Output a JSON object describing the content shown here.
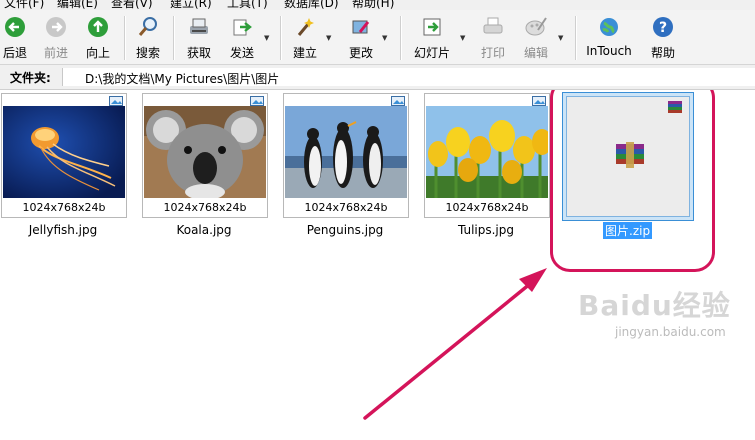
{
  "menu": [
    "文件(F)",
    "编辑(E)",
    "查看(V)",
    "建立(R)",
    "工具(T)",
    "数据库(D)",
    "帮助(H)"
  ],
  "toolbar": {
    "back": "后退",
    "forward": "前进",
    "up": "向上",
    "search": "搜索",
    "acquire": "获取",
    "send": "发送",
    "create": "建立",
    "modify": "更改",
    "slideshow": "幻灯片",
    "print": "打印",
    "edit": "编辑",
    "intouch": "InTouch",
    "help": "帮助"
  },
  "address": {
    "label": "文件夹:",
    "path": "D:\\我的文档\\My Pictures\\图片\\图片"
  },
  "files": [
    {
      "name": "Jellyfish.jpg",
      "dims": "1024x768x24b"
    },
    {
      "name": "Koala.jpg",
      "dims": "1024x768x24b"
    },
    {
      "name": "Penguins.jpg",
      "dims": "1024x768x24b"
    },
    {
      "name": "Tulips.jpg",
      "dims": "1024x768x24b"
    }
  ],
  "selected_file": {
    "name": "图片.zip"
  },
  "watermark": {
    "brand": "Baidu经验",
    "url": "jingyan.baidu.com"
  },
  "colors": {
    "highlight": "#d4145a",
    "selection": "#3399ff"
  }
}
